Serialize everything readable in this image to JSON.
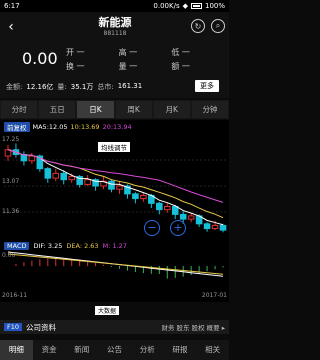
{
  "status": {
    "time": "6:17",
    "speed": "0.00K/s",
    "battery": "100%"
  },
  "header": {
    "title": "新能源",
    "subtitle": "881118",
    "back_icon": "chevron-left-icon",
    "refresh_icon": "refresh-icon",
    "search_icon": "search-icon"
  },
  "quote": {
    "price": "0.00",
    "cells": [
      "开 一",
      "高 一",
      "低 一",
      "换 一",
      "量 一",
      "额 一"
    ],
    "turnover_label": "金额:",
    "turnover_value": "12.16亿",
    "volume_label": "量:",
    "volume_value": "35.1万",
    "amount_label": "总市:",
    "amount_value": "161.31",
    "more_label": "更多"
  },
  "tabs": [
    "分时",
    "五日",
    "日K",
    "周K",
    "月K",
    "分钟"
  ],
  "chart": {
    "badge": "前复权",
    "ma5": "MA5:12.05",
    "ma10": "10:13.69",
    "ma20": "20:13.94",
    "y_labels": [
      "17.25",
      "13.07",
      "11.36"
    ],
    "pan_label": "均线调节",
    "colors": {
      "up": "#e03030",
      "down": "#17c0d8",
      "ma5": "#ffffff",
      "ma10": "#e8c84a",
      "ma20": "#d84ad8"
    }
  },
  "chart_data": {
    "type": "candlestick",
    "candles": [
      {
        "o": 16.2,
        "c": 16.6,
        "h": 16.9,
        "l": 15.9
      },
      {
        "o": 16.6,
        "c": 16.3,
        "h": 17.0,
        "l": 16.1
      },
      {
        "o": 16.3,
        "c": 15.9,
        "h": 16.5,
        "l": 15.6
      },
      {
        "o": 15.9,
        "c": 16.2,
        "h": 16.4,
        "l": 15.7
      },
      {
        "o": 16.2,
        "c": 15.4,
        "h": 16.3,
        "l": 15.2
      },
      {
        "o": 15.4,
        "c": 14.8,
        "h": 15.5,
        "l": 14.5
      },
      {
        "o": 14.8,
        "c": 15.1,
        "h": 15.4,
        "l": 14.6
      },
      {
        "o": 15.1,
        "c": 14.7,
        "h": 15.3,
        "l": 14.4
      },
      {
        "o": 14.7,
        "c": 14.9,
        "h": 15.1,
        "l": 14.5
      },
      {
        "o": 14.9,
        "c": 14.4,
        "h": 15.0,
        "l": 14.2
      },
      {
        "o": 14.4,
        "c": 14.7,
        "h": 15.0,
        "l": 14.3
      },
      {
        "o": 14.7,
        "c": 14.3,
        "h": 14.8,
        "l": 14.0
      },
      {
        "o": 14.3,
        "c": 14.6,
        "h": 14.9,
        "l": 14.1
      },
      {
        "o": 14.6,
        "c": 14.1,
        "h": 14.7,
        "l": 13.9
      },
      {
        "o": 14.1,
        "c": 14.3,
        "h": 14.6,
        "l": 13.8
      },
      {
        "o": 14.3,
        "c": 13.8,
        "h": 14.4,
        "l": 13.5
      },
      {
        "o": 13.8,
        "c": 13.5,
        "h": 13.9,
        "l": 13.2
      },
      {
        "o": 13.5,
        "c": 13.7,
        "h": 13.9,
        "l": 13.3
      },
      {
        "o": 13.7,
        "c": 13.2,
        "h": 13.8,
        "l": 12.9
      },
      {
        "o": 13.2,
        "c": 12.8,
        "h": 13.3,
        "l": 12.5
      },
      {
        "o": 12.8,
        "c": 13.0,
        "h": 13.2,
        "l": 12.6
      },
      {
        "o": 13.0,
        "c": 12.5,
        "h": 13.1,
        "l": 12.2
      },
      {
        "o": 12.5,
        "c": 12.2,
        "h": 12.7,
        "l": 11.9
      },
      {
        "o": 12.2,
        "c": 12.4,
        "h": 12.6,
        "l": 12.0
      },
      {
        "o": 12.4,
        "c": 11.9,
        "h": 12.5,
        "l": 11.7
      },
      {
        "o": 11.9,
        "c": 11.6,
        "h": 12.0,
        "l": 11.4
      },
      {
        "o": 11.6,
        "c": 11.8,
        "h": 12.1,
        "l": 11.5
      },
      {
        "o": 11.8,
        "c": 11.5,
        "h": 11.9,
        "l": 11.36
      }
    ],
    "ylim": [
      11.0,
      17.6
    ]
  },
  "macd": {
    "badge": "MACD",
    "dif": "DIF: 3.25",
    "dea": "DEA: 2.63",
    "m": "M: 1.27",
    "y_label": "0.00",
    "x_start": "2016-11",
    "x_end": "2017-01",
    "center_label": "大数据"
  },
  "news": {
    "badge": "F10",
    "title": "公司资料",
    "links": "财务 股东 股权 概要 ▸"
  },
  "bottom_tabs": [
    "明细",
    "资金",
    "新闻",
    "公告",
    "分析",
    "研报",
    "相关"
  ]
}
